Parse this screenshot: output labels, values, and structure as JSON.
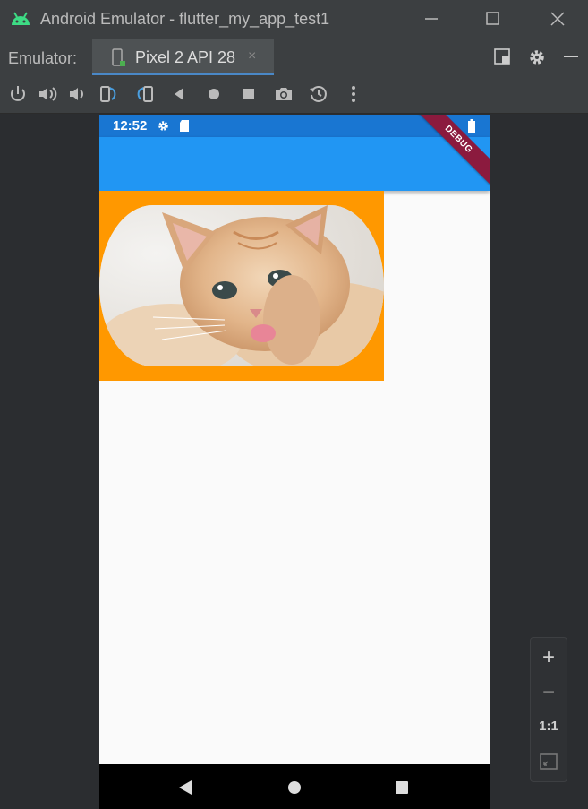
{
  "window": {
    "title": "Android Emulator - flutter_my_app_test1",
    "icons": [
      "android-icon",
      "minimize-icon",
      "maximize-icon",
      "close-icon"
    ]
  },
  "tabbar": {
    "label": "Emulator:",
    "tab_name": "Pixel 2 API 28",
    "tab_close": "×"
  },
  "toolbar": {
    "buttons": [
      "power",
      "volume-up",
      "volume-down",
      "rotate-left",
      "rotate-right",
      "back",
      "home",
      "overview",
      "screenshot",
      "snapshot",
      "more"
    ]
  },
  "device": {
    "status_time": "12:52",
    "debug_banner": "DEBUG",
    "app_bar_color": "#2196f3",
    "status_bar_color": "#1976d2",
    "image_border_color": "#ff9800",
    "image_subject": "kitten"
  },
  "zoom_controls": {
    "zoom_in": "+",
    "zoom_out": "−",
    "one_to_one": "1:1"
  }
}
